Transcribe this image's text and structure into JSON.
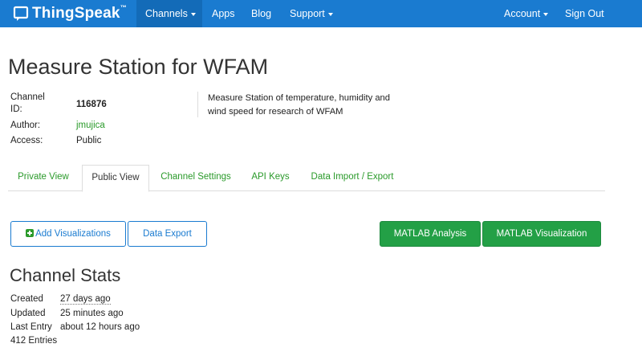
{
  "nav": {
    "brand": "ThingSpeak",
    "brand_tm": "™",
    "channels": "Channels",
    "apps": "Apps",
    "blog": "Blog",
    "support": "Support",
    "account": "Account",
    "sign_out": "Sign Out",
    "colors": {
      "navbar": "#1a7bd0",
      "active": "#136bb8"
    }
  },
  "page": {
    "title": "Measure Station for WFAM"
  },
  "channel": {
    "id_label_1": "Channel",
    "id_label_2": "ID:",
    "id_value": "116876",
    "author_label": "Author:",
    "author_value": "jmujica",
    "access_label": "Access:",
    "access_value": "Public",
    "description": "Measure Station of temperature, humidity and wind speed for research of WFAM"
  },
  "tabs": [
    {
      "label": "Private View",
      "active": false
    },
    {
      "label": "Public View",
      "active": true
    },
    {
      "label": "Channel Settings",
      "active": false
    },
    {
      "label": "API Keys",
      "active": false
    },
    {
      "label": "Data Import / Export",
      "active": false
    }
  ],
  "buttons": {
    "add_visualizations": "Add Visualizations",
    "add_icon": "plus-square-icon",
    "data_export": "Data Export",
    "matlab_analysis": "MATLAB Analysis",
    "matlab_visualization": "MATLAB Visualization",
    "green": "#23a046"
  },
  "stats": {
    "title": "Channel Stats",
    "created_label": "Created",
    "created_value": "27 days ago",
    "updated_label": "Updated",
    "updated_value": "25 minutes ago",
    "last_entry_label": "Last Entry",
    "last_entry_value": "about 12 hours ago",
    "entries": "412 Entries"
  }
}
